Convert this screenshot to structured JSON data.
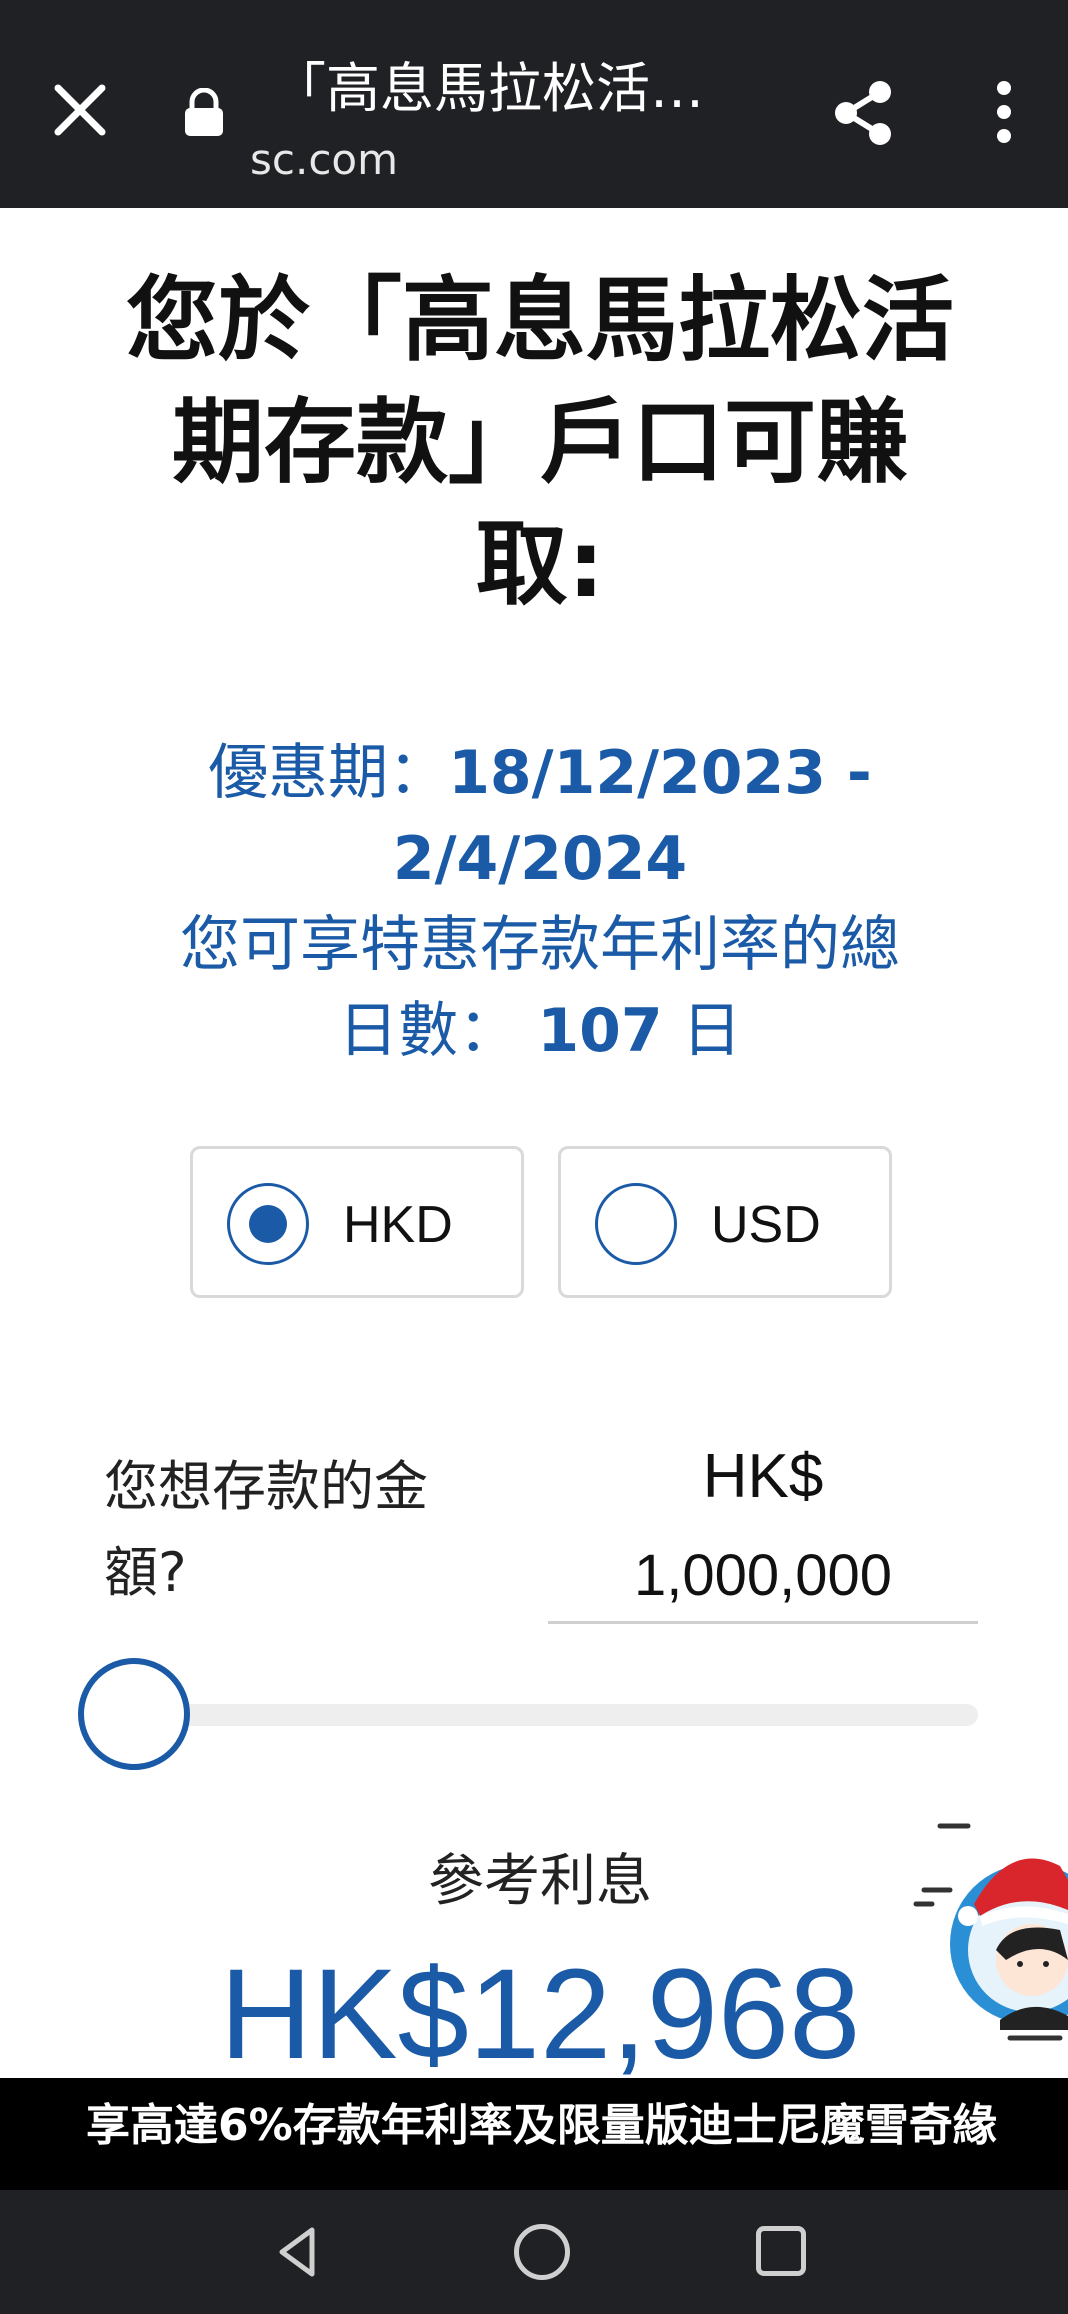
{
  "browser": {
    "title": "「高息馬拉松活…",
    "url": "sc.com"
  },
  "heading": {
    "line1": "您於「高息馬拉松活",
    "line2": "期存款」戶口可賺",
    "line3": "取:"
  },
  "promo": {
    "period_label": "優惠期：",
    "period_value_start": "18/12/2023 -",
    "period_value_end": "2/4/2024",
    "days_label_line1": "您可享特惠存款年利率的總",
    "days_label_line2": "日數：",
    "days_value": "107",
    "days_unit": "日"
  },
  "currency": {
    "options": [
      {
        "label": "HKD",
        "selected": true
      },
      {
        "label": "USD",
        "selected": false
      }
    ]
  },
  "amount": {
    "label_line1": "您想存款的金",
    "label_line2": "額?",
    "currency": "HK$",
    "value": "1,000,000",
    "slider_fraction": 0.0
  },
  "interest": {
    "label": "參考利息",
    "value": "HK$12,968"
  },
  "banner": {
    "text": "享高達6%存款年利率及限量版迪士尼魔雪奇緣"
  },
  "colors": {
    "accent": "#1a5aa6",
    "topbar": "#202124"
  }
}
